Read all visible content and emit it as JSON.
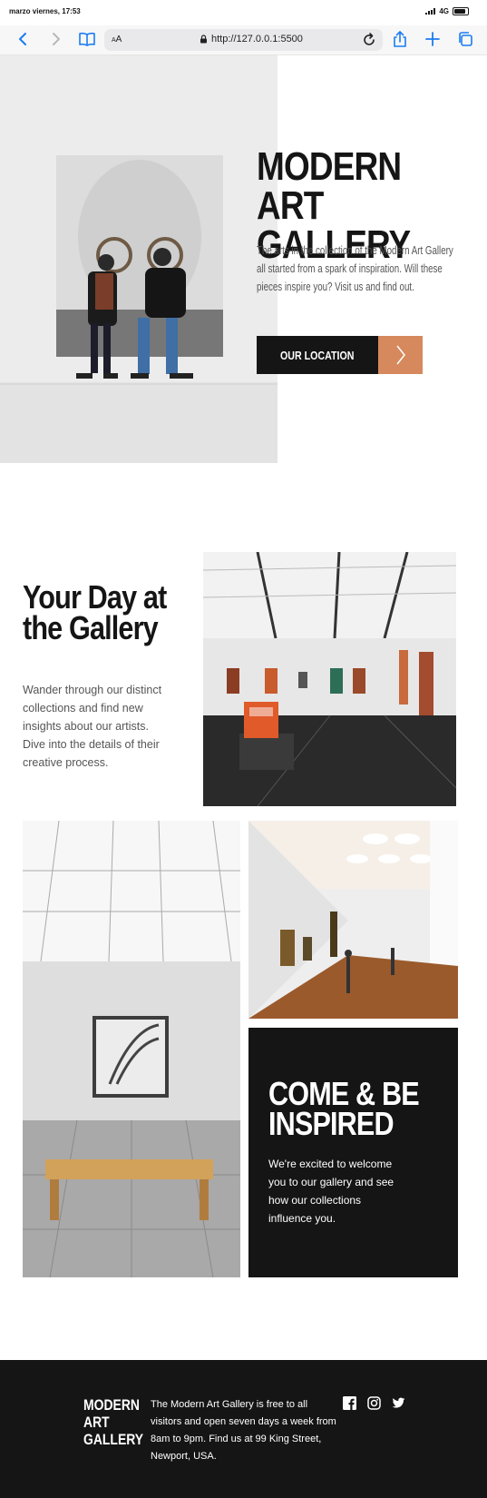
{
  "status_bar": {
    "time": "marzo viernes, 17:53",
    "network": "4G"
  },
  "browser": {
    "text_size_label_small": "A",
    "text_size_label_large": "A",
    "url": "http://127.0.0.1:5500",
    "icons": [
      "back-icon",
      "forward-icon",
      "bookmarks-icon",
      "text-size-icon",
      "lock-icon",
      "reload-icon",
      "share-icon",
      "new-tab-icon",
      "tabs-icon"
    ]
  },
  "hero": {
    "title_line1": "MODERN ART",
    "title_line2": "GALLERY",
    "description": "The arts in the collection of the Modern Art Gallery all started from a spark of inspiration. Will these pieces inspire you? Visit us and find out.",
    "button_label": "OUR LOCATION",
    "button_accent": "#d5895d"
  },
  "day": {
    "title_line1": "Your Day at",
    "title_line2": "the Gallery",
    "description": "Wander through our distinct collections and find new insights about our artists. Dive into the details of their creative process."
  },
  "inspire": {
    "title_line1": "COME & BE",
    "title_line2": "INSPIRED",
    "description": "We're excited to welcome you to our gallery and see how our collections influence you."
  },
  "footer": {
    "logo_line1": "MODERN",
    "logo_line2": "ART",
    "logo_line3": "GALLERY",
    "text": "The Modern Art Gallery is free to all visitors and open seven days a week from 8am to 9pm. Find us at 99 King Street, Newport, USA.",
    "social": [
      "facebook-icon",
      "instagram-icon",
      "twitter-icon"
    ]
  },
  "colors": {
    "dark": "#151515",
    "accent": "#d5895d",
    "link_blue": "#1a7cf2"
  }
}
